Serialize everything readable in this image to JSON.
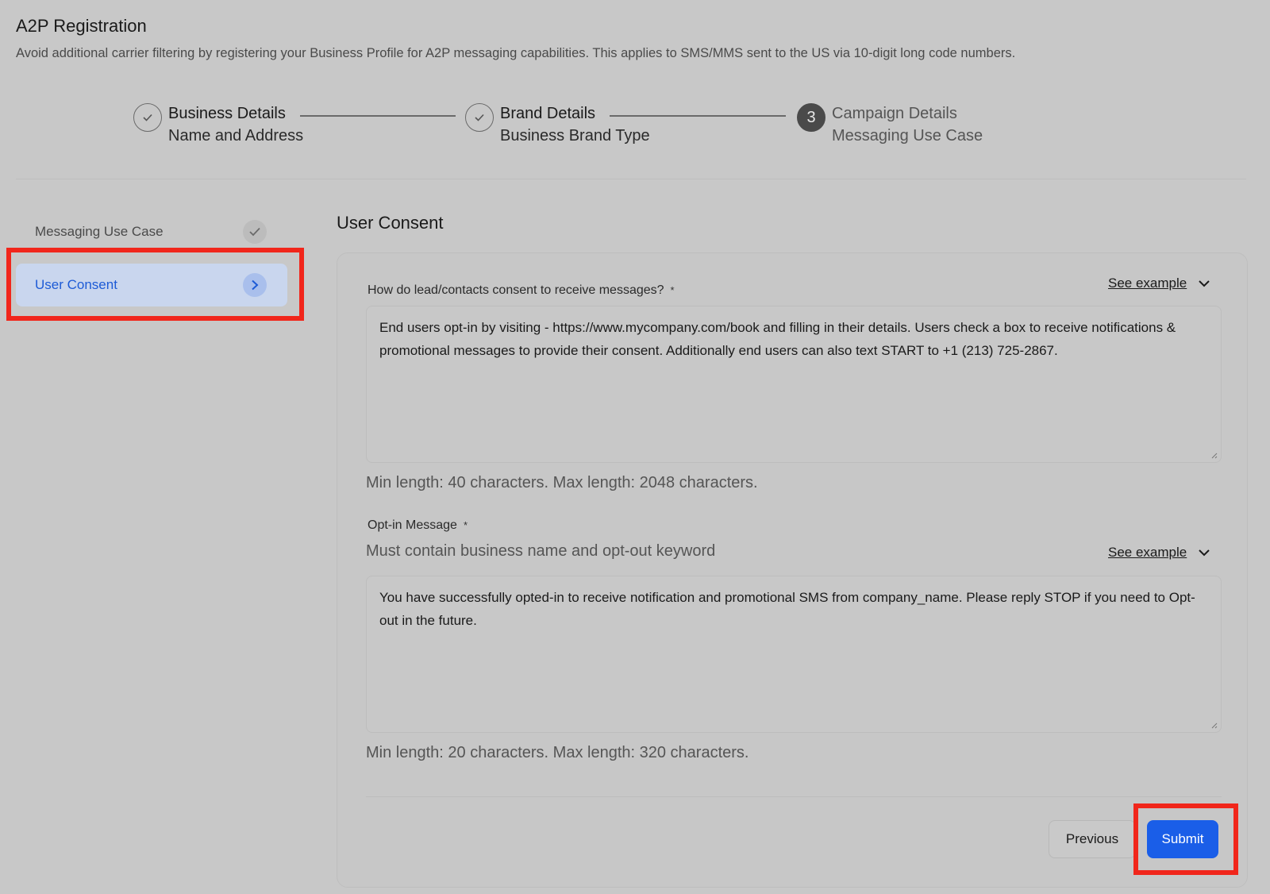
{
  "header": {
    "title": "A2P Registration",
    "subtitle": "Avoid additional carrier filtering by registering your Business Profile for A2P messaging capabilities. This applies to SMS/MMS sent to the US via 10-digit long code numbers."
  },
  "stepper": {
    "steps": [
      {
        "title": "Business Details",
        "subtitle": "Name and Address",
        "status": "completed",
        "icon": "check-icon"
      },
      {
        "title": "Brand Details",
        "subtitle": "Business Brand Type",
        "status": "completed",
        "icon": "check-icon"
      },
      {
        "title": "Campaign Details",
        "subtitle": "Messaging Use Case",
        "status": "active",
        "number": "3"
      }
    ]
  },
  "sidebar": {
    "items": [
      {
        "label": "Messaging Use Case",
        "status": "completed",
        "icon": "check-icon"
      },
      {
        "label": "User Consent",
        "status": "active",
        "icon": "chevron-right-icon"
      }
    ]
  },
  "main": {
    "section_title": "User Consent",
    "fields": [
      {
        "label": "How do lead/contacts consent to receive messages?",
        "required_mark": "*",
        "see_example": "See example",
        "value": "End users opt-in by visiting - https://www.mycompany.com/book and filling in their details. Users check a box to receive notifications & promotional messages to provide their consent. Additionally end users can also text START to +1 (213) 725-2867.",
        "help": "Min length: 40 characters. Max length: 2048 characters."
      },
      {
        "label": "Opt-in Message",
        "required_mark": "*",
        "hint": "Must contain business name and opt-out keyword",
        "see_example": "See example",
        "value": "You have successfully opted-in to receive notification and promotional SMS from company_name. Please reply STOP if you need to Opt-out in the future.",
        "help": "Min length: 20 characters. Max length: 320 characters."
      }
    ],
    "buttons": {
      "previous": "Previous",
      "submit": "Submit"
    }
  },
  "colors": {
    "accent": "#1a5ee8",
    "highlight": "#f1261b",
    "active_nav_bg": "#c9d6ee",
    "background": "#c8c8c8"
  }
}
